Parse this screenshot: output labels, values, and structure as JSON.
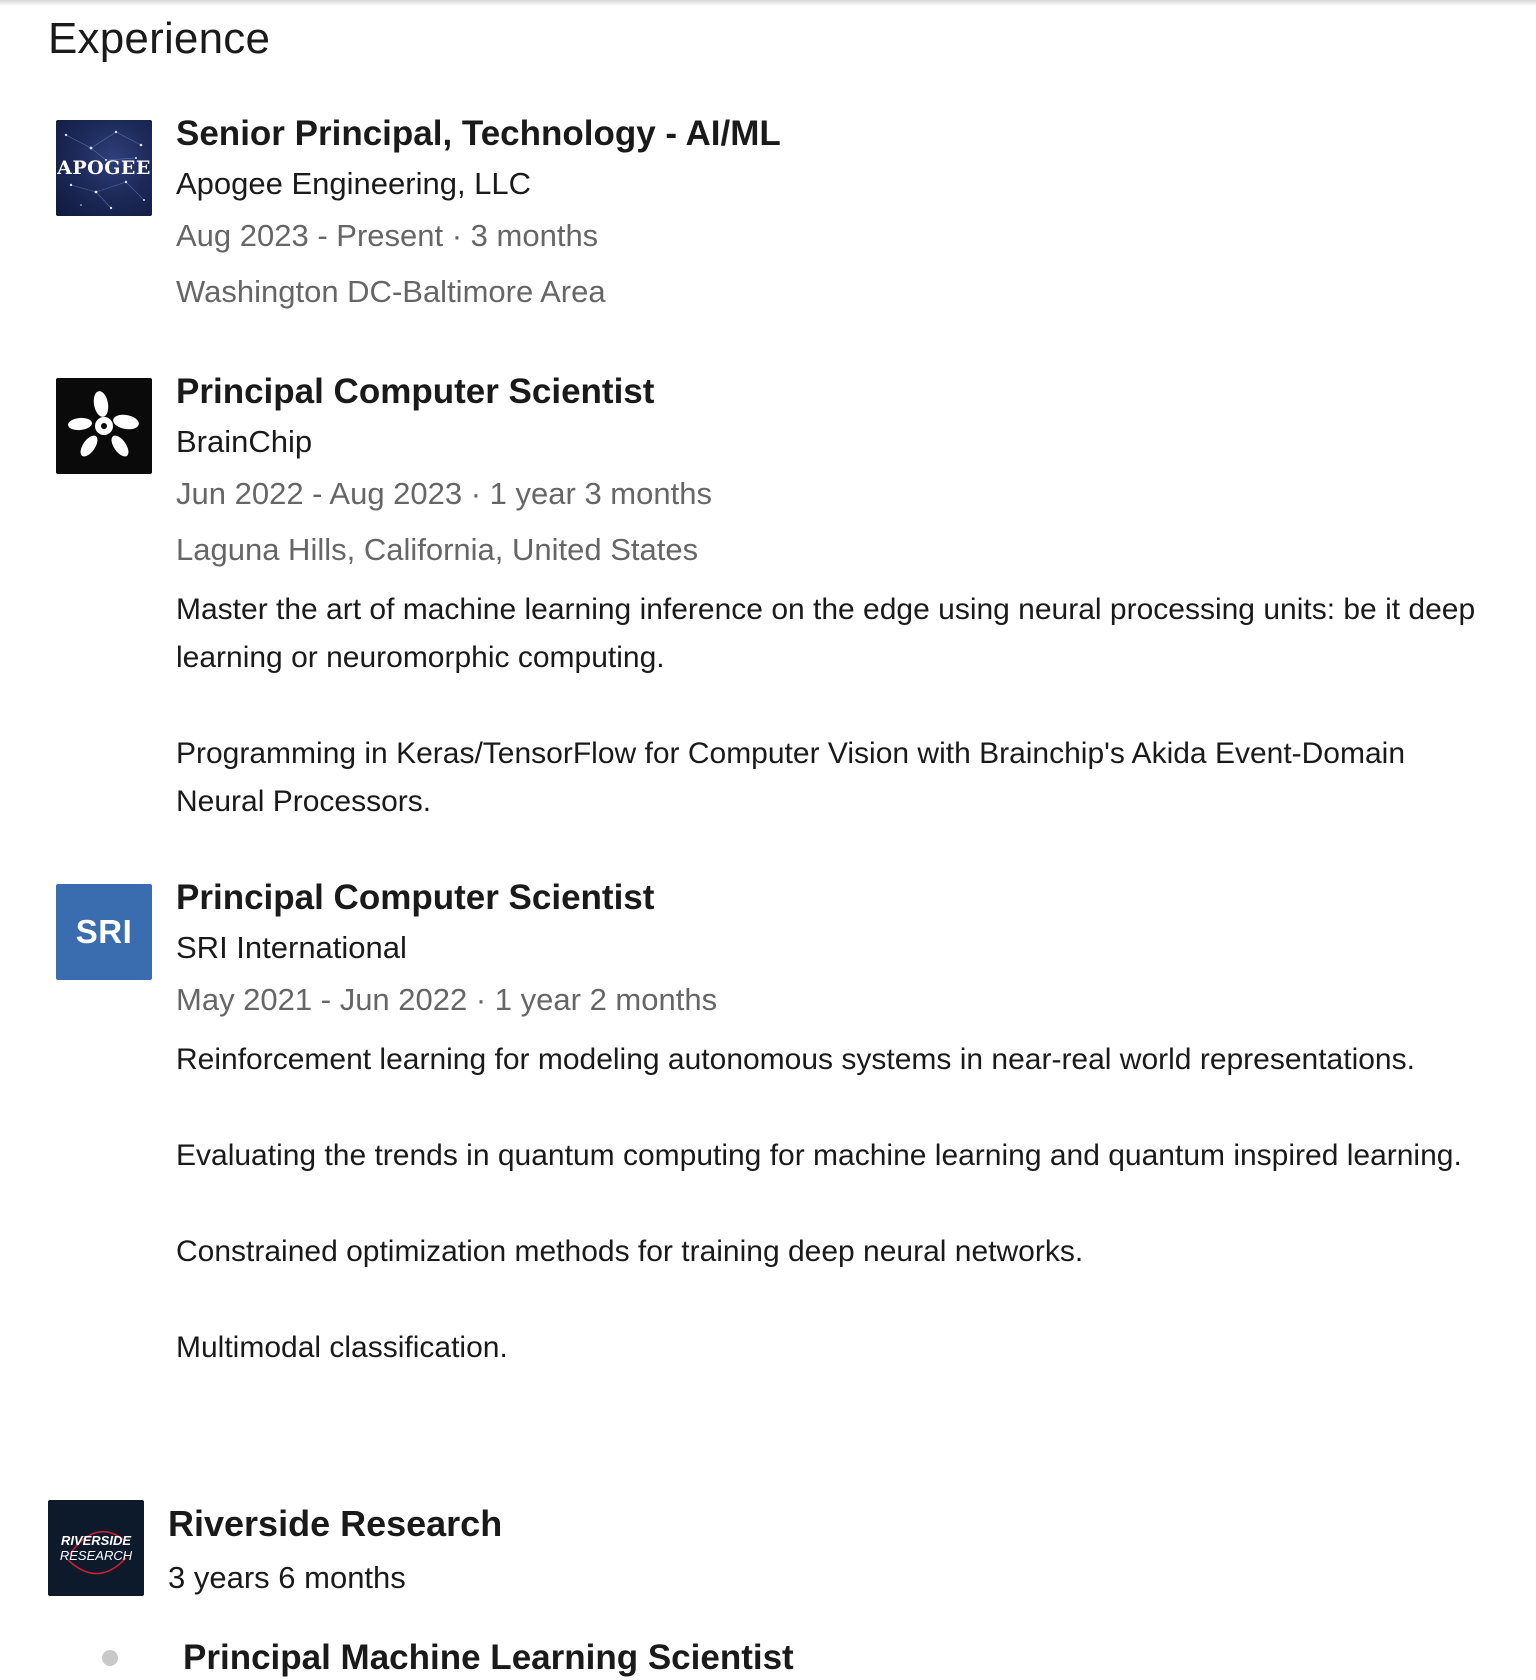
{
  "section": {
    "title": "Experience"
  },
  "entries": [
    {
      "logo_text": "APOGEE",
      "title": "Senior Principal, Technology - AI/ML",
      "company": "Apogee Engineering, LLC",
      "dates": "Aug 2023 - Present · 3 months",
      "location": "Washington DC-Baltimore Area",
      "description": []
    },
    {
      "logo_text": "",
      "title": "Principal Computer Scientist",
      "company": "BrainChip",
      "dates": "Jun 2022 - Aug 2023 · 1 year 3 months",
      "location": "Laguna Hills, California, United States",
      "description": [
        "Master the art of machine learning inference on the edge using neural processing units: be it deep learning or neuromorphic computing.",
        "Programming in Keras/TensorFlow for Computer Vision with Brainchip's Akida Event-Domain Neural Processors."
      ]
    },
    {
      "logo_text": "SRI",
      "title": "Principal Computer Scientist",
      "company": "SRI International",
      "dates": "May 2021 - Jun 2022 · 1 year 2 months",
      "location": "",
      "description": [
        "Reinforcement learning for modeling autonomous systems in near-real world representations.",
        "Evaluating the trends in quantum computing for machine learning and quantum inspired learning.",
        "Constrained optimization methods for training deep neural networks.",
        "Multimodal classification."
      ]
    }
  ],
  "group": {
    "logo_line1": "RIVERSIDE",
    "logo_line2": "RESEARCH",
    "company": "Riverside Research",
    "duration": "3 years 6 months",
    "first_role_title": "Principal Machine Learning Scientist"
  },
  "colors": {
    "text_primary": "#1a1a1a",
    "text_secondary": "#666666",
    "apogee_bg": "#1d2a5a",
    "brainchip_bg": "#0a0a0a",
    "sri_bg": "#3a6db0",
    "riverside_bg": "#0d1a2c"
  }
}
